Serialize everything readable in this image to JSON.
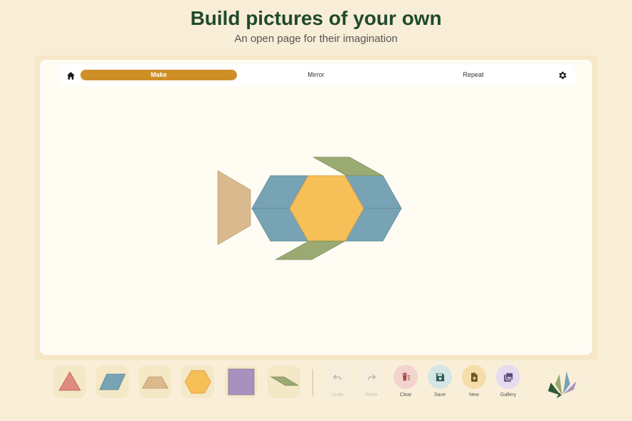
{
  "hero": {
    "title": "Build pictures of your own",
    "subtitle": "An open page for their imagination"
  },
  "topbar": {
    "home_icon": "home-icon",
    "settings_icon": "gear-icon",
    "tabs": [
      {
        "label": "Make",
        "active": true
      },
      {
        "label": "Mirror",
        "active": false
      },
      {
        "label": "Repeat",
        "active": false
      }
    ],
    "accent_color": "#cf8f27"
  },
  "canvas": {
    "pieces": [
      {
        "shape": "trapezoid",
        "color": "#dbb98e"
      },
      {
        "shape": "rhombus",
        "color": "#77a3b5"
      },
      {
        "shape": "rhombus",
        "color": "#77a3b5"
      },
      {
        "shape": "rhombus",
        "color": "#77a3b5"
      },
      {
        "shape": "rhombus",
        "color": "#77a3b5"
      },
      {
        "shape": "hexagon",
        "color": "#f7bf57"
      },
      {
        "shape": "thin-rhombus",
        "color": "#9aaa72"
      },
      {
        "shape": "thin-rhombus",
        "color": "#9aaa72"
      }
    ]
  },
  "palette": [
    {
      "shape": "triangle",
      "color": "#dd8a7f"
    },
    {
      "shape": "rhombus",
      "color": "#77a3b5"
    },
    {
      "shape": "trapezoid",
      "color": "#dbb98e"
    },
    {
      "shape": "hexagon",
      "color": "#f7bf57"
    },
    {
      "shape": "square",
      "color": "#a892bd"
    },
    {
      "shape": "thin-rhombus",
      "color": "#9aaa72"
    }
  ],
  "actions": [
    {
      "label": "Undo",
      "icon": "undo-icon",
      "enabled": false,
      "bg": "#f6eedc"
    },
    {
      "label": "Redo",
      "icon": "redo-icon",
      "enabled": false,
      "bg": "#f6eedc"
    },
    {
      "label": "Clear",
      "icon": "trash-icon",
      "enabled": true,
      "bg": "#f3d3cd"
    },
    {
      "label": "Save",
      "icon": "save-icon",
      "enabled": true,
      "bg": "#d5e6e4"
    },
    {
      "label": "New",
      "icon": "new-page-icon",
      "enabled": true,
      "bg": "#f5deaa"
    },
    {
      "label": "Gallery",
      "icon": "gallery-icon",
      "enabled": true,
      "bg": "#e5dcef"
    }
  ]
}
